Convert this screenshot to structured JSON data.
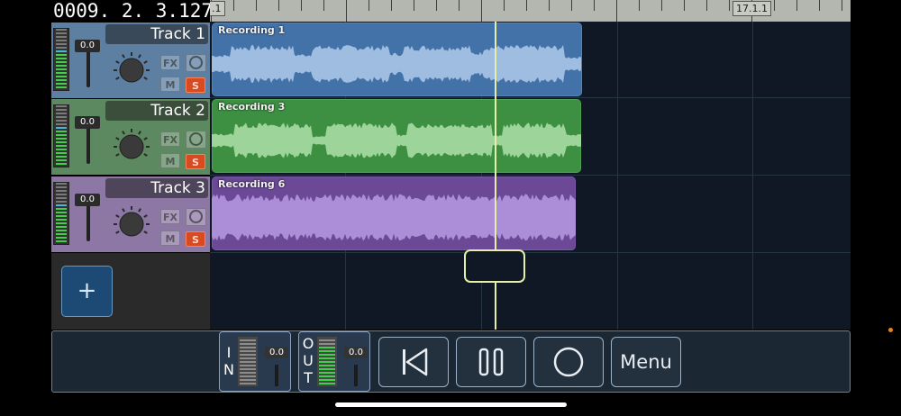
{
  "position": {
    "counter": "0009. 2. 3.127"
  },
  "ruler": {
    "left_marker": ".1",
    "marker": "17.1.1"
  },
  "tracks": [
    {
      "name": "Track 1",
      "volume": "0.0",
      "fx_label": "FX",
      "mute_label": "M",
      "solo_label": "S",
      "colors": {
        "header": "#5d7fa2",
        "clip": "#4372a8",
        "wave": "#a9c5e7",
        "clip_edge": "#6a95c6"
      },
      "clip": {
        "label": "Recording 1"
      }
    },
    {
      "name": "Track 2",
      "volume": "0.0",
      "fx_label": "FX",
      "mute_label": "M",
      "solo_label": "S",
      "colors": {
        "header": "#5d8960",
        "clip": "#3d8f42",
        "wave": "#a6dca3",
        "clip_edge": "#5fb064"
      },
      "clip": {
        "label": "Recording 3"
      }
    },
    {
      "name": "Track 3",
      "volume": "0.0",
      "fx_label": "FX",
      "mute_label": "M",
      "solo_label": "S",
      "colors": {
        "header": "#8c77a5",
        "clip": "#6b4996",
        "wave": "#b495de",
        "clip_edge": "#8b67b9"
      },
      "clip": {
        "label": "Recording 6"
      }
    }
  ],
  "add_track": {
    "label": "+"
  },
  "transport": {
    "input": {
      "letters": [
        "I",
        "N"
      ],
      "volume": "0.0"
    },
    "output": {
      "letters": [
        "O",
        "U",
        "T"
      ],
      "volume": "0.0"
    },
    "menu_label": "Menu"
  },
  "colors": {
    "accent": "#e6efa8",
    "background": "#0f1824",
    "solo": "#d84a1f"
  }
}
